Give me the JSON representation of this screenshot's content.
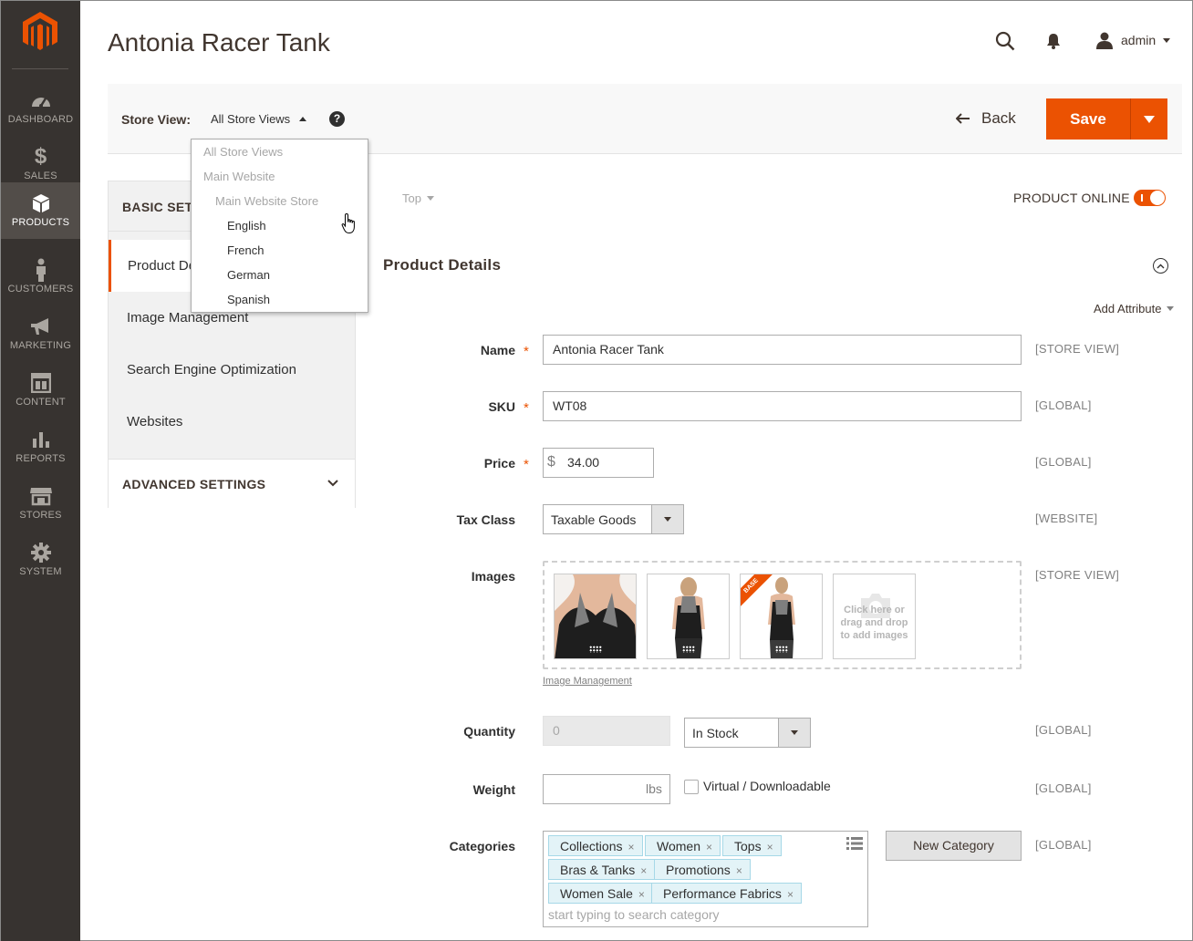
{
  "nav": {
    "items": [
      {
        "label": "DASHBOARD",
        "icon": "dashboard-icon"
      },
      {
        "label": "SALES",
        "icon": "dollar-icon"
      },
      {
        "label": "PRODUCTS",
        "icon": "box-icon"
      },
      {
        "label": "CUSTOMERS",
        "icon": "person-icon"
      },
      {
        "label": "MARKETING",
        "icon": "megaphone-icon"
      },
      {
        "label": "CONTENT",
        "icon": "layout-icon"
      },
      {
        "label": "REPORTS",
        "icon": "bar-chart-icon"
      },
      {
        "label": "STORES",
        "icon": "storefront-icon"
      },
      {
        "label": "SYSTEM",
        "icon": "gear-icon"
      }
    ],
    "active_index": 2
  },
  "header": {
    "title": "Antonia Racer Tank",
    "user": "admin"
  },
  "actions": {
    "store_view_label": "Store View:",
    "store_view_value": "All Store Views",
    "help": "?",
    "back_label": "Back",
    "save_label": "Save"
  },
  "store_view_dropdown": {
    "options": [
      {
        "label": "All Store Views",
        "enabled": false,
        "level": 0
      },
      {
        "label": "Main Website",
        "enabled": false,
        "level": 0
      },
      {
        "label": "Main Website Store",
        "enabled": false,
        "level": 1
      },
      {
        "label": "English",
        "enabled": true,
        "level": 2
      },
      {
        "label": "French",
        "enabled": true,
        "level": 2
      },
      {
        "label": "German",
        "enabled": true,
        "level": 2
      },
      {
        "label": "Spanish",
        "enabled": true,
        "level": 2
      }
    ]
  },
  "tabs": {
    "basic_heading": "BASIC SETT",
    "items": [
      "Product De",
      "Image Management",
      "Search Engine Optimization",
      "Websites"
    ],
    "advanced_heading": "ADVANCED SETTINGS"
  },
  "main": {
    "scope_switcher": "Top",
    "product_online_label": "PRODUCT ONLINE",
    "product_online": true,
    "section_title": "Product Details",
    "add_attribute": "Add Attribute"
  },
  "form": {
    "name": {
      "label": "Name",
      "value": "Antonia Racer Tank",
      "scope": "[STORE VIEW]",
      "required": true
    },
    "sku": {
      "label": "SKU",
      "value": "WT08",
      "scope": "[GLOBAL]",
      "required": true
    },
    "price": {
      "label": "Price",
      "currency": "$",
      "value": "34.00",
      "scope": "[GLOBAL]",
      "required": true
    },
    "tax_class": {
      "label": "Tax Class",
      "value": "Taxable Goods",
      "scope": "[WEBSITE]"
    },
    "images": {
      "label": "Images",
      "scope": "[STORE VIEW]",
      "base_badge": "BASE",
      "upload_text": "Click here or drag and drop to add images",
      "link": "Image Management"
    },
    "quantity": {
      "label": "Quantity",
      "value": "0",
      "stock_status": "In Stock",
      "scope": "[GLOBAL]"
    },
    "weight": {
      "label": "Weight",
      "unit": "lbs",
      "value": "",
      "virtual_label": "Virtual / Downloadable",
      "virtual_checked": false,
      "scope": "[GLOBAL]"
    },
    "categories": {
      "label": "Categories",
      "chips": [
        "Collections",
        "Women",
        "Tops",
        "Bras & Tanks",
        "Promotions",
        "Women Sale",
        "Performance Fabrics"
      ],
      "remove_glyph": "×",
      "placeholder": "start typing to search category",
      "new_button": "New Category",
      "scope": "[GLOBAL]"
    }
  }
}
